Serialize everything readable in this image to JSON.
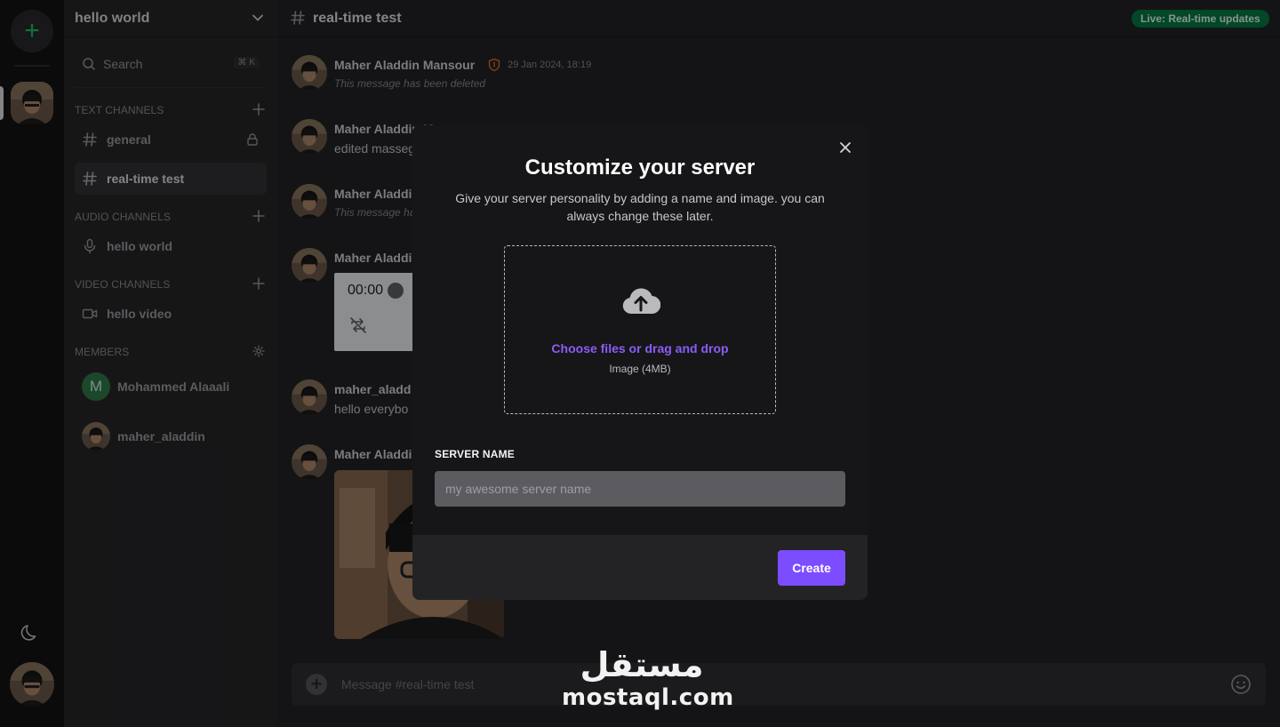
{
  "server": {
    "name": "hello world",
    "search_label": "Search",
    "search_shortcut": "⌘ K",
    "sections": {
      "text": "TEXT CHANNELS",
      "audio": "AUDIO CHANNELS",
      "video": "VIDEO CHANNELS",
      "members": "MEMBERS"
    },
    "text_channels": [
      {
        "name": "general",
        "locked": true
      },
      {
        "name": "real-time test",
        "active": true
      }
    ],
    "audio_channels": [
      {
        "name": "hello world"
      }
    ],
    "video_channels": [
      {
        "name": "hello video"
      }
    ],
    "members": [
      {
        "name": "Mohammed Alaaali",
        "initial": "M"
      },
      {
        "name": "maher_aladdin"
      }
    ]
  },
  "channel": {
    "name": "real-time test",
    "live_badge": "Live: Real-time updates",
    "composer_placeholder": "Message #real-time test"
  },
  "messages": [
    {
      "author": "Maher Aladdin Mansour",
      "time": "29 Jan 2024, 18:19",
      "text": "This message has been deleted",
      "deleted": true
    },
    {
      "author": "Maher Aladdin M",
      "text": "edited masseg"
    },
    {
      "author": "Maher Aladdi",
      "text": "This message ha",
      "deleted": true
    },
    {
      "author": "Maher Aladdi",
      "audio_time": "00:00"
    },
    {
      "author": "maher_aladd",
      "text": "hello everybo"
    },
    {
      "author": "Maher Aladdi",
      "image": true
    }
  ],
  "modal": {
    "title": "Customize your server",
    "description": "Give your server personality by adding a name and image. you can always change these later.",
    "upload_cta": "Choose files or drag and drop",
    "upload_hint": "Image (4MB)",
    "field_label": "SERVER NAME",
    "field_placeholder": "my awesome server name",
    "field_value": "",
    "create_label": "Create"
  },
  "watermark": {
    "arabic": "مستقل",
    "latin": "mostaql.com"
  },
  "colors": {
    "accent": "#7c4dff",
    "link": "#8b5cf6",
    "live_badge": "#047a44",
    "add_server": "#22c55e"
  }
}
